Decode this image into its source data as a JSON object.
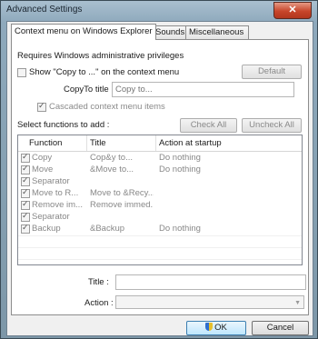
{
  "window": {
    "title": "Advanced Settings",
    "close_label": "✕"
  },
  "tabs": [
    {
      "label": "Context menu on Windows Explorer"
    },
    {
      "label": "Sounds"
    },
    {
      "label": "Miscellaneous"
    }
  ],
  "context": {
    "requires_text": "Requires Windows administrative privileges",
    "show_copy_label": "Show \"Copy to ...\" on the context menu",
    "default_button": "Default",
    "copyto_title_label": "CopyTo title :",
    "copyto_title_placeholder": "Copy to...",
    "cascaded_label": "Cascaded context menu items",
    "select_functions_label": "Select functions to add :",
    "check_all_button": "Check All",
    "uncheck_all_button": "Uncheck All"
  },
  "table": {
    "columns": [
      "Function",
      "Title",
      "Action at startup"
    ],
    "rows": [
      {
        "function": "Copy",
        "title": "Cop&y to...",
        "action": "Do nothing"
      },
      {
        "function": "Move",
        "title": "&Move to...",
        "action": "Do nothing"
      },
      {
        "function": "Separator",
        "title": "",
        "action": ""
      },
      {
        "function": "Move to R...",
        "title": "Move to &Recy...",
        "action": ""
      },
      {
        "function": "Remove im...",
        "title": "Remove immed...",
        "action": ""
      },
      {
        "function": "Separator",
        "title": "",
        "action": ""
      },
      {
        "function": "Backup",
        "title": "&Backup",
        "action": "Do nothing"
      }
    ]
  },
  "bottom": {
    "title_label": "Title :",
    "title_value": "",
    "action_label": "Action :",
    "action_value": "",
    "ok_button": "OK",
    "cancel_button": "Cancel"
  },
  "icons": {
    "uac": "uac-shield-icon",
    "dropdown": "chevron-down-icon"
  }
}
